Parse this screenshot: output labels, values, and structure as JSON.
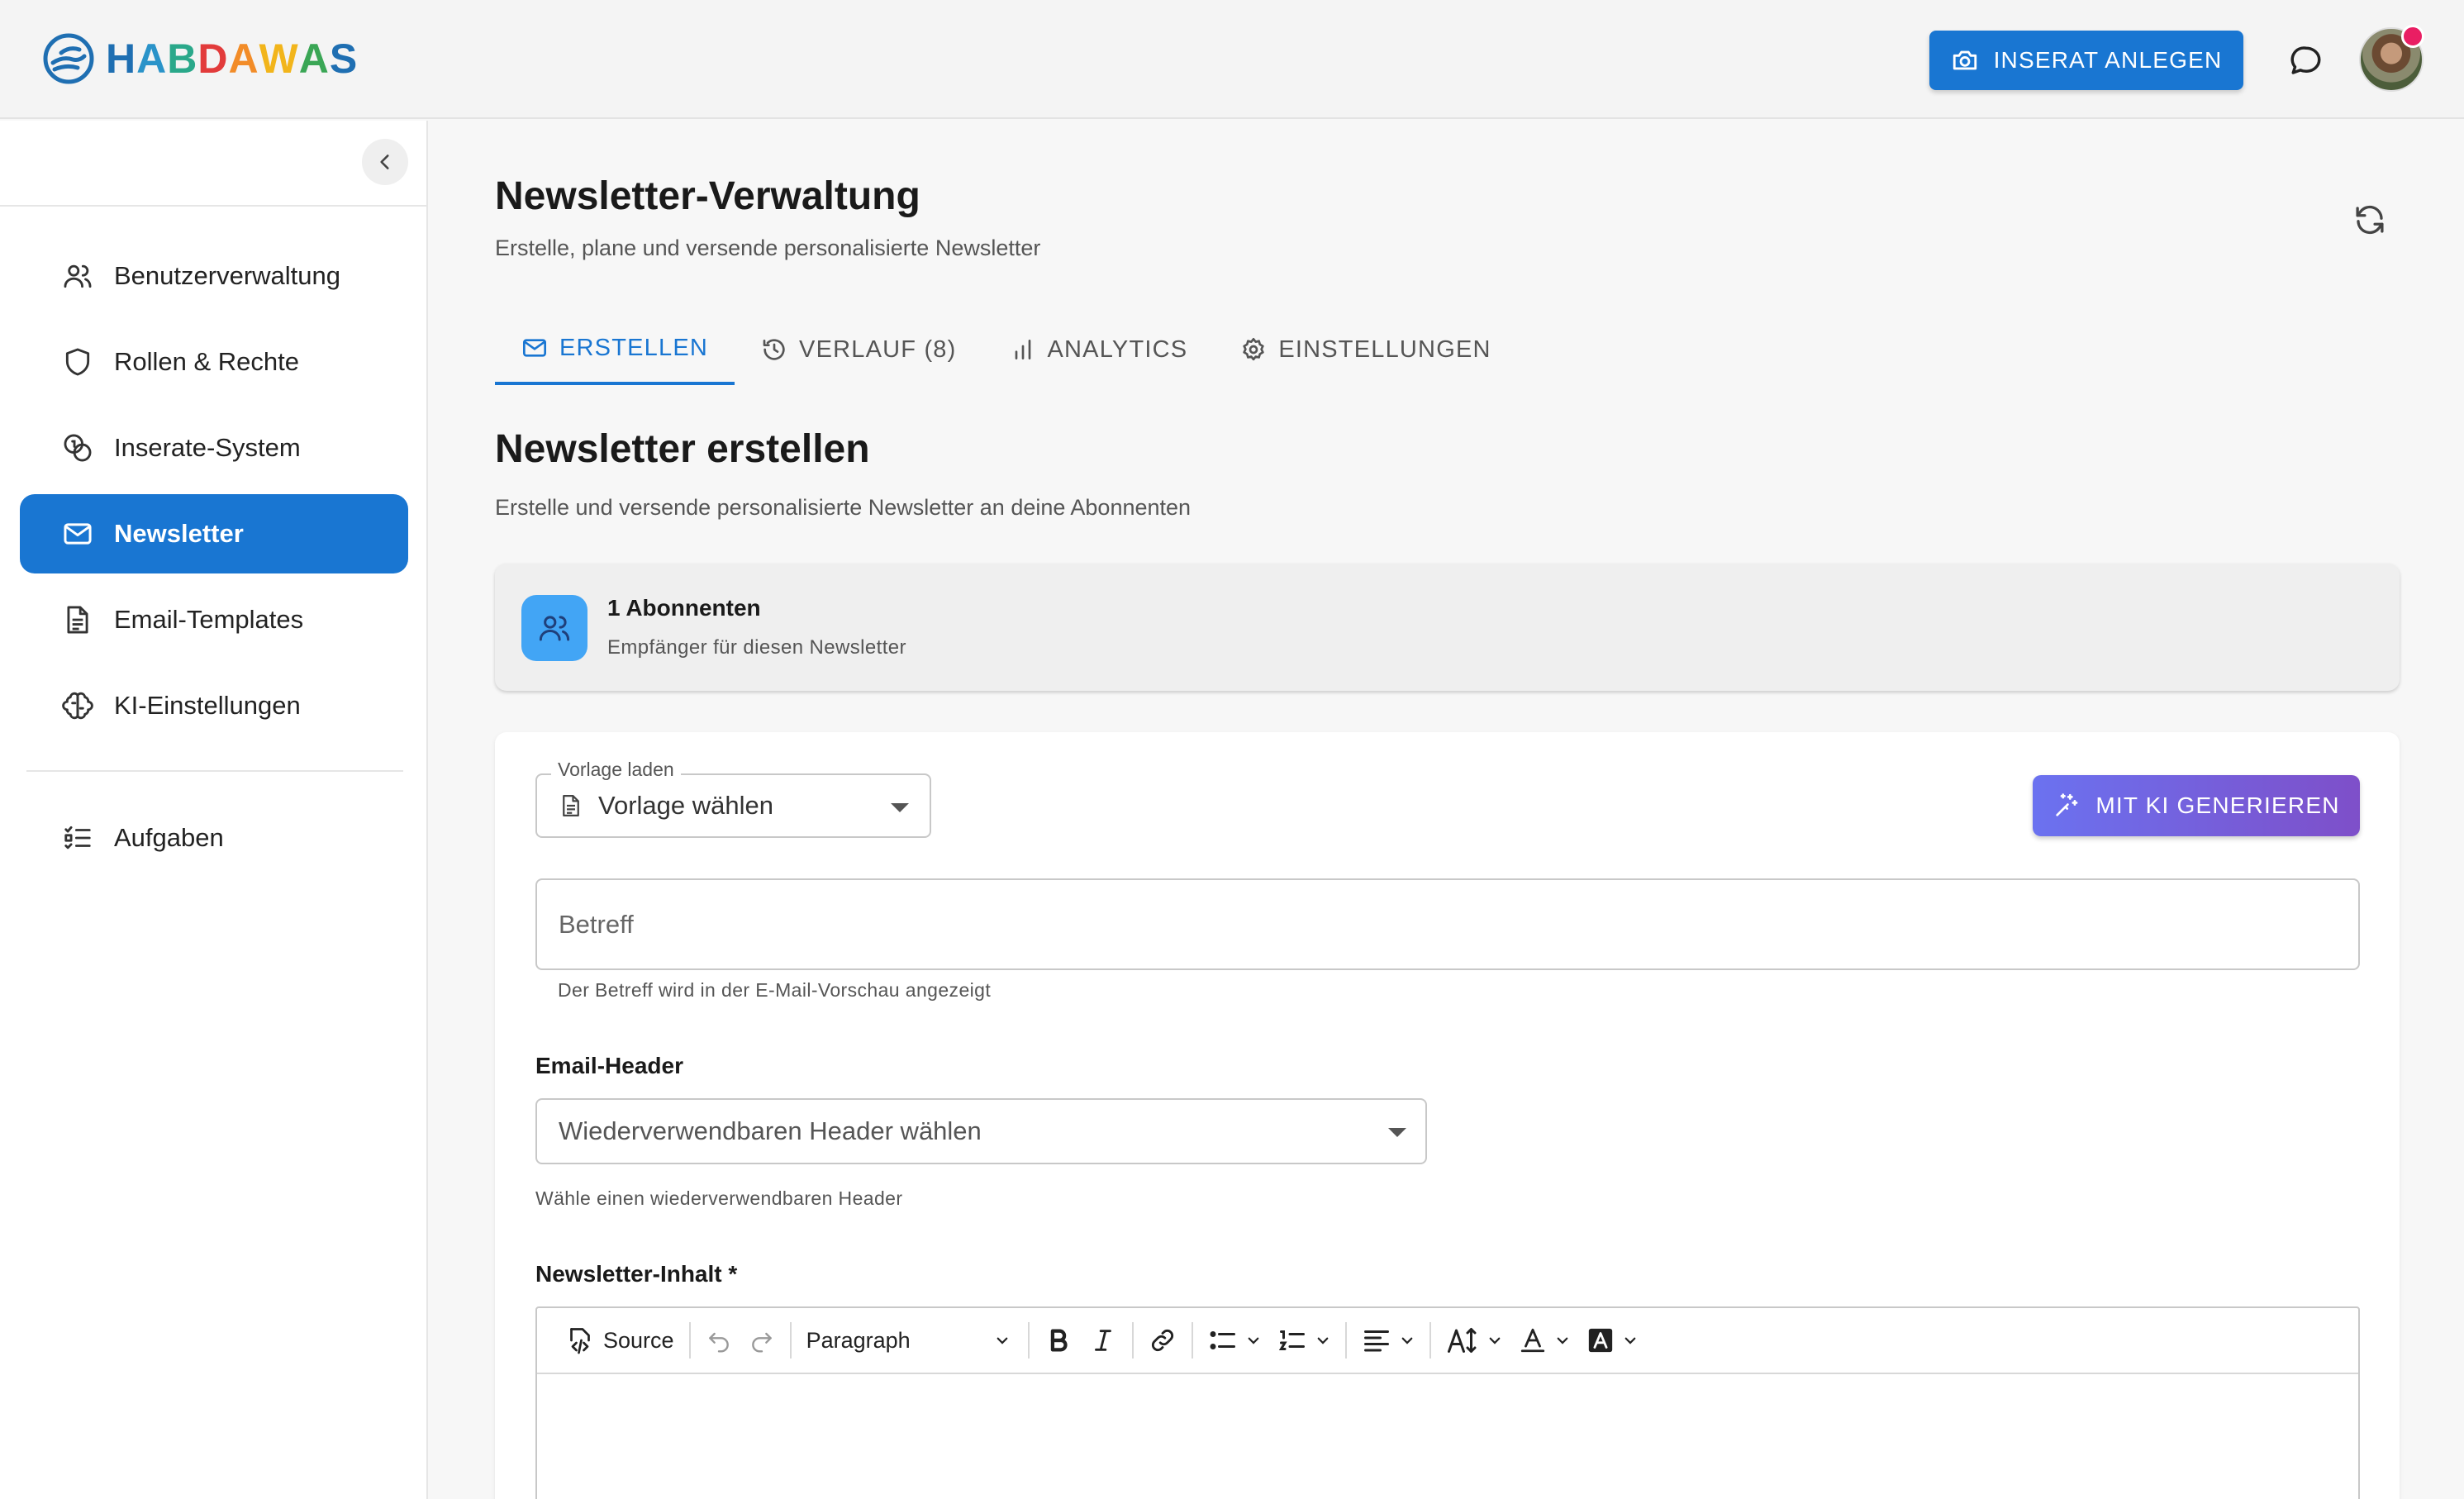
{
  "app": {
    "brand": "HABDAWAS",
    "create_listing_label": "INSERAT ANLEGEN",
    "colors": {
      "primary": "#1976d2",
      "ai_gradient_start": "#6b72f0",
      "ai_gradient_end": "#7e4fc9",
      "badge": "#e91e63",
      "subscriber_icon_bg": "#42a5f5"
    }
  },
  "sidebar": {
    "items": [
      {
        "label": "Benutzerverwaltung",
        "icon": "users-icon"
      },
      {
        "label": "Rollen & Rechte",
        "icon": "shield-icon"
      },
      {
        "label": "Inserate-System",
        "icon": "coins-icon"
      },
      {
        "label": "Newsletter",
        "icon": "mail-icon",
        "active": true
      },
      {
        "label": "Email-Templates",
        "icon": "document-icon"
      },
      {
        "label": "KI-Einstellungen",
        "icon": "brain-icon"
      }
    ],
    "secondary": [
      {
        "label": "Aufgaben",
        "icon": "task-list-icon"
      }
    ]
  },
  "page": {
    "title": "Newsletter-Verwaltung",
    "subtitle": "Erstelle, plane und versende personalisierte Newsletter"
  },
  "tabs": [
    {
      "label": "ERSTELLEN",
      "icon": "mail-icon",
      "active": true
    },
    {
      "label": "VERLAUF (8)",
      "icon": "history-icon"
    },
    {
      "label": "ANALYTICS",
      "icon": "bar-chart-icon"
    },
    {
      "label": "EINSTELLUNGEN",
      "icon": "gear-icon"
    }
  ],
  "create": {
    "title": "Newsletter erstellen",
    "subtitle": "Erstelle und versende personalisierte Newsletter an deine Abonnenten",
    "subscribers": {
      "count_label": "1 Abonnenten",
      "description": "Empfänger für diesen Newsletter"
    },
    "template_select": {
      "label": "Vorlage laden",
      "value": "Vorlage wählen"
    },
    "ai_button_label": "MIT KI GENERIEREN",
    "subject": {
      "placeholder": "Betreff",
      "helper": "Der Betreff wird in der E-Mail-Vorschau angezeigt"
    },
    "email_header": {
      "label": "Email-Header",
      "placeholder": "Wiederverwendbaren Header wählen",
      "helper": "Wähle einen wiederverwendbaren Header"
    },
    "content": {
      "label": "Newsletter-Inhalt *",
      "toolbar": {
        "source_label": "Source",
        "paragraph_label": "Paragraph"
      }
    }
  }
}
